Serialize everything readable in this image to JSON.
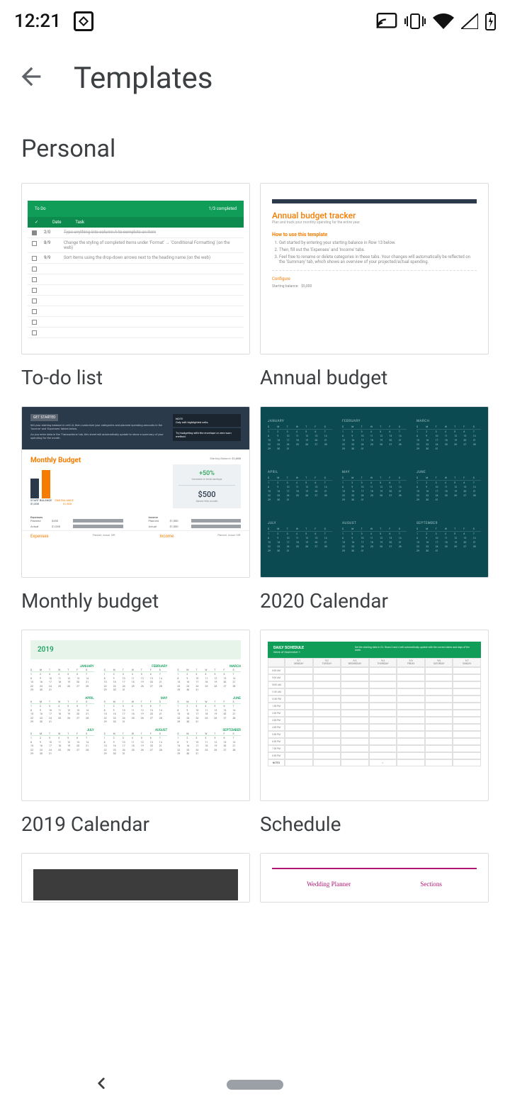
{
  "status": {
    "time": "12:21"
  },
  "appbar": {
    "title": "Templates"
  },
  "section": {
    "title": "Personal"
  },
  "templates": [
    {
      "label": "To-do list"
    },
    {
      "label": "Annual budget"
    },
    {
      "label": "Monthly budget"
    },
    {
      "label": "2020 Calendar"
    },
    {
      "label": "2019 Calendar"
    },
    {
      "label": "Schedule"
    }
  ],
  "preview": {
    "todo": {
      "title": "To Do",
      "progress": "1/3 completed",
      "col_date": "Date",
      "col_task": "Task",
      "hint": "Type anything into column A to complete an item"
    },
    "annual": {
      "title": "Annual budget tracker",
      "subtitle": "Plan and track your monthly spending for the entire year.",
      "howto": "How to use this template",
      "configure": "Configure",
      "balance_label": "Starting balance:",
      "balance_value": "$5,000"
    },
    "monthly": {
      "getstarted": "GET STARTED",
      "title": "Monthly Budget",
      "note": "NOTE",
      "note_body": "Only edit highlighted cells.",
      "starting_label": "Starting Balance:",
      "starting_value": "$1,000",
      "start_label": "START BALANCE",
      "end_label": "END BALANCE",
      "start_amt": "$1,000",
      "end_amt": "$1,500",
      "pct": "+50%",
      "pct_sub": "Increase in total savings",
      "saved": "$500",
      "saved_sub": "Saved this month",
      "expenses": "Expenses",
      "income": "Income",
      "planned": "Planned",
      "actual": "Actual",
      "diff": "Diff.",
      "e_planned": "$450",
      "e_actual": "$1,000",
      "i_planned": "$1,500",
      "i_actual": "$1,000"
    },
    "cal2020": {
      "months": [
        "JANUARY",
        "FEBRUARY",
        "MARCH",
        "APRIL",
        "MAY",
        "JUNE",
        "JULY",
        "AUGUST",
        "SEPTEMBER"
      ]
    },
    "cal2019": {
      "year": "2019",
      "months": [
        "JANUARY",
        "FEBRUARY",
        "MARCH",
        "APRIL",
        "MAY",
        "JUNE",
        "JULY",
        "AUGUST",
        "SEPTEMBER"
      ]
    },
    "schedule": {
      "title": "DAILY SCHEDULE",
      "week": "Week of   September 1",
      "note": "Set the starting date in C2. Rows 3 and 4 will automatically update with the correct dates and days of the week.",
      "days": [
        "9/1 MONDAY",
        "9/2 TUESDAY",
        "9/3 WEDNESDAY",
        "9/4 THURSDAY",
        "9/5 FRIDAY",
        "9/6 SATURDAY",
        "9/7 SUNDAY"
      ]
    },
    "stub2": {
      "a": "Wedding Planner",
      "b": "Sections"
    }
  }
}
